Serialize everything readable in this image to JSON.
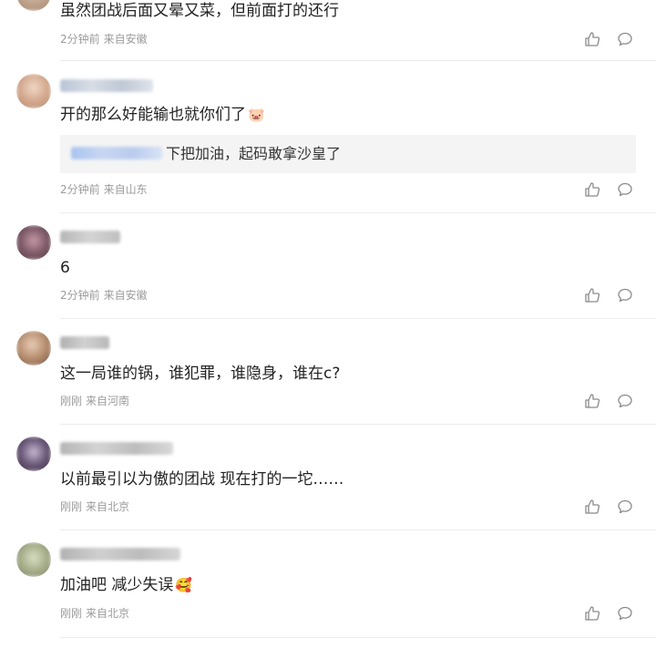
{
  "comments": [
    {
      "text": "虽然团战后面又晕又菜，但前面打的还行",
      "time": "2分钟前",
      "location": "来自安徽"
    },
    {
      "text": "开的那么好能输也就你们了",
      "emoji": "🐷",
      "reply": {
        "text": "下把加油，起码敢拿沙皇了"
      },
      "time": "2分钟前",
      "location": "来自山东"
    },
    {
      "text": "6",
      "time": "2分钟前",
      "location": "来自安徽"
    },
    {
      "text": "这一局谁的锅，谁犯罪，谁隐身，谁在c?",
      "time": "刚刚",
      "location": "来自河南"
    },
    {
      "text": "以前最引以为傲的团战 现在打的一坨……",
      "time": "刚刚",
      "location": "来自北京"
    },
    {
      "text": "加油吧 减少失误",
      "emoji": "🥰",
      "time": "刚刚",
      "location": "来自北京"
    }
  ],
  "icons": {
    "like": "thumbs-up-icon",
    "reply": "comment-bubble-icon"
  },
  "colors": {
    "meta": "#9b9b9b",
    "text": "#222222",
    "divider": "#ececec",
    "reply_bg": "#f4f4f4"
  }
}
